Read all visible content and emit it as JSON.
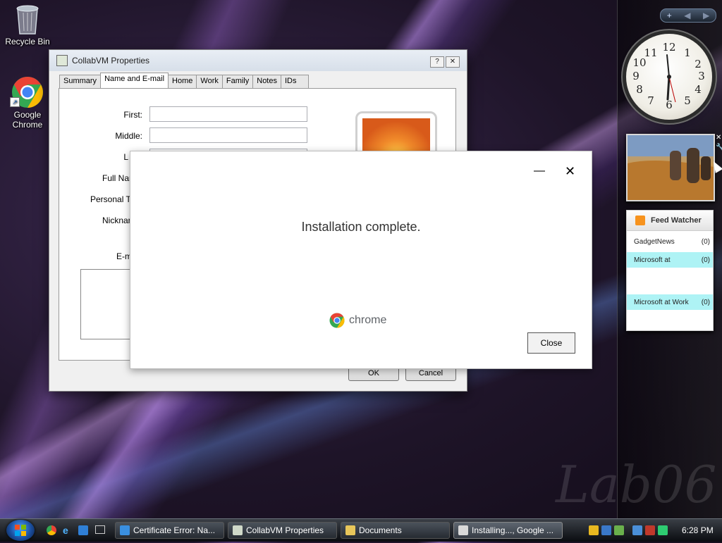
{
  "desktop": {
    "icons": [
      {
        "label": "Recycle Bin"
      },
      {
        "label": "Google Chrome"
      }
    ],
    "watermark": "Lab06"
  },
  "sidebar": {
    "feed_watcher": {
      "title": "Feed Watcher",
      "items": [
        {
          "name": "GadgetNews",
          "count": "(0)"
        },
        {
          "name": "Microsoft at",
          "count": "(0)"
        },
        {
          "name": "Microsoft at Work",
          "count": "(0)"
        }
      ]
    },
    "clock_numbers": [
      "12",
      "1",
      "2",
      "3",
      "4",
      "5",
      "6",
      "7",
      "8",
      "9",
      "10",
      "11"
    ]
  },
  "properties_window": {
    "title": "CollabVM Properties",
    "tabs": [
      "Summary",
      "Name and E-mail",
      "Home",
      "Work",
      "Family",
      "Notes",
      "IDs"
    ],
    "active_tab": "Name and E-mail",
    "labels": {
      "first": "First:",
      "middle": "Middle:",
      "last": "L",
      "full_name": "Full Nar",
      "personal_title": "Personal Ti",
      "nickname": "Nicknar",
      "email": "E-m"
    },
    "fields": {
      "first": "",
      "middle": "",
      "last": ""
    },
    "ok_label": "OK",
    "cancel_label": "Cancel"
  },
  "chrome_dialog": {
    "message": "Installation complete.",
    "brand": "chrome",
    "close_label": "Close",
    "minimize_glyph": "—",
    "close_glyph": "✕"
  },
  "taskbar": {
    "tasks": [
      {
        "label": "Certificate Error: Na...",
        "active": false
      },
      {
        "label": "CollabVM Properties",
        "active": false
      },
      {
        "label": "Documents",
        "active": false
      },
      {
        "label": "Installing..., Google ...",
        "active": true
      }
    ],
    "time": "6:28 PM"
  },
  "colors": {
    "chrome_red": "#ea4335",
    "chrome_yellow": "#fbbc05",
    "chrome_green": "#34a853",
    "chrome_blue": "#4285f4",
    "feed_highlight": "#aef3f5"
  }
}
